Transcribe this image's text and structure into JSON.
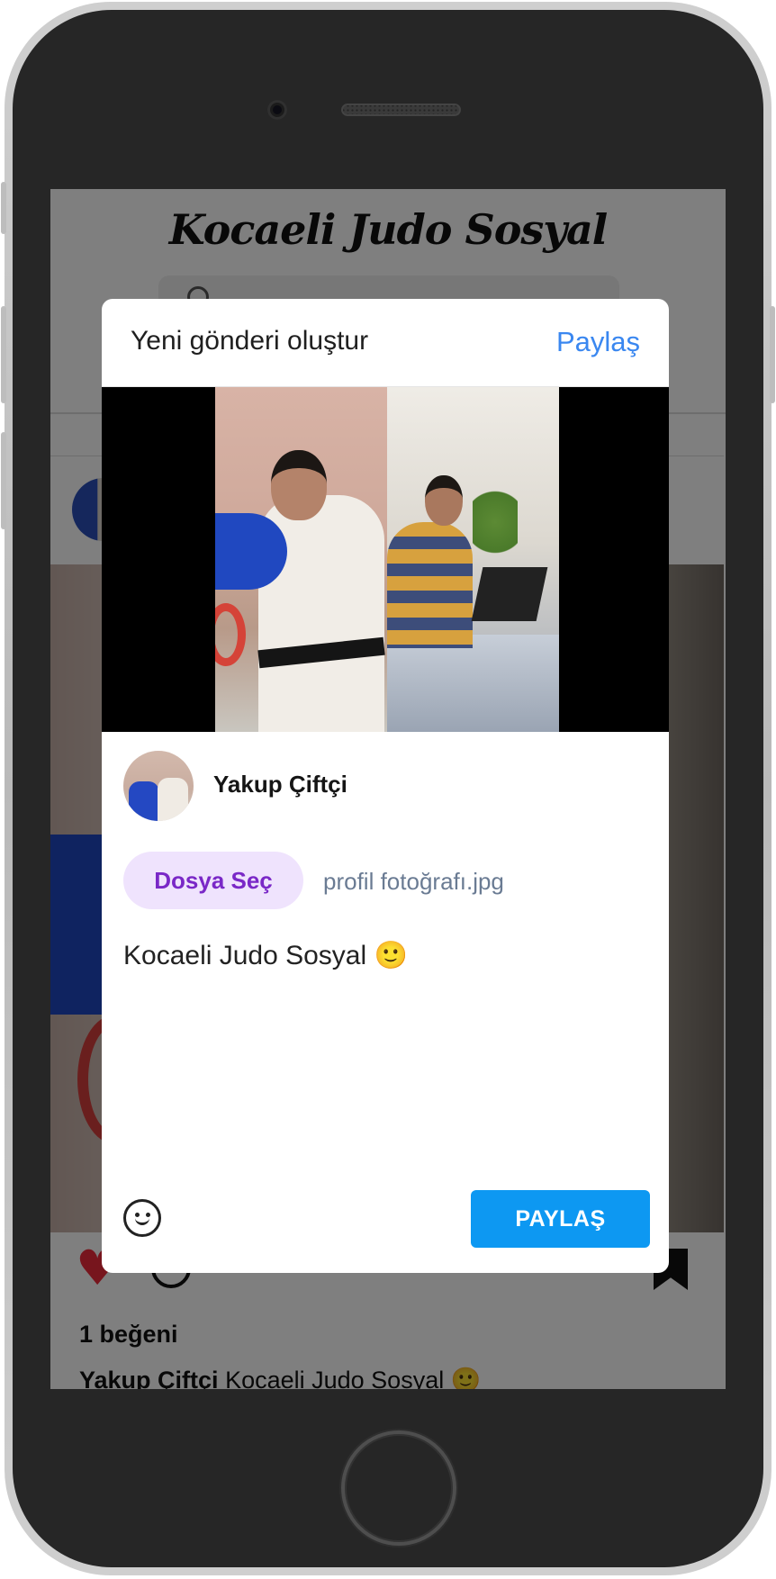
{
  "app": {
    "logo_text": "Kocaeli Judo Sosyal"
  },
  "feed_post": {
    "likes_text": "1 beğeni",
    "caption_user": "Yakup Çiftçi",
    "caption_text": "Kocaeli Judo Sosyal 🙂",
    "liked": true
  },
  "modal": {
    "title": "Yeni gönderi oluştur",
    "header_share_label": "Paylaş",
    "user_name": "Yakup Çiftçi",
    "file_button_label": "Dosya Seç",
    "file_name": "profil fotoğrafı.jpg",
    "caption_value": "Kocaeli Judo Sosyal 🙂",
    "submit_label": "PAYLAŞ"
  },
  "colors": {
    "link_blue": "#3a87f0",
    "submit_blue": "#0d98f2",
    "file_button_bg": "#efe3fd",
    "file_button_text": "#7a28c7",
    "like_red": "#ee2b3b"
  },
  "icons": {
    "emoji": "smiley-face-icon",
    "like": "heart-icon",
    "comment": "comment-bubble-icon",
    "save": "bookmark-icon",
    "search": "search-icon"
  }
}
